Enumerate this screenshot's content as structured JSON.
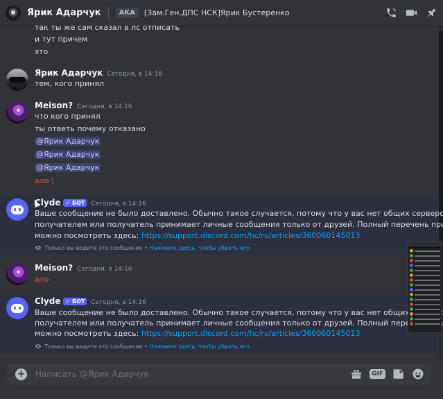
{
  "header": {
    "username": "Ярик Адарчук",
    "aka_badge": "AKA",
    "alias": "[Зам.Ген.ДПС НСК]Ярик Бустеренко",
    "icons": [
      "voice-call-icon",
      "video-call-icon",
      "pin-icon"
    ]
  },
  "messages": [
    {
      "author": "",
      "timestamp": "",
      "lines": [
        "так ты же сам сказал в лс отписать",
        "и тут причем",
        "это"
      ]
    },
    {
      "author": "Ярик Адарчук",
      "timestamp": "Сегодня, в 14:16",
      "lines": [
        "тем, кого принял"
      ]
    },
    {
      "author": "Meison?",
      "timestamp": "Сегодня, в 14:16",
      "lines": [
        "что кого принял",
        "ты ответь почему отказано"
      ],
      "mentions": [
        "@Ярик Адарчук",
        "@Ярик Адарчук",
        "@Ярик Адарчук"
      ],
      "red_line": "ало \\"
    },
    {
      "author": "Clyde",
      "bot_tag": "БОТ",
      "timestamp": "Сегодня, в 14:16",
      "lines": [
        "Ваше сообщение не было доставлено. Обычно такое случается, потому что у вас нет общих серверов с",
        "получателем или получатель принимает личные сообщения только от друзей. Полный перечень причин"
      ],
      "last_line_prefix": "можно посмотреть здесь: ",
      "link": "https://support.discord.com/hc/ru/articles/360060145013",
      "ephemeral_note": "Только вы видите это сообщение •",
      "dismiss": "Нажмите здесь, чтобы убрать его"
    },
    {
      "author": "Meison?",
      "timestamp": "Сегодня, в 14:16",
      "red_line": "ало"
    },
    {
      "author": "Clyde",
      "bot_tag": "БОТ",
      "timestamp": "Сегодня, в 14:16",
      "lines": [
        "Ваше сообщение не было доставлено. Обычно такое случается, потому что у вас нет общих серверов с",
        "получателем или получатель принимает личные сообщения только от друзей. Полный перечень причин"
      ],
      "last_line_prefix": "можно посмотреть здесь: ",
      "link": "https://support.discord.com/hc/ru/articles/360060145013",
      "ephemeral_note": "Только вы видите это сообщение •",
      "dismiss": "Нажмите здесь, чтобы убрать его"
    }
  ],
  "input": {
    "placeholder": "Написать @Ярик Адарчук",
    "gif_label": "GIF",
    "icons": [
      "gift-icon",
      "gif-icon",
      "sticker-icon",
      "emoji-icon"
    ]
  },
  "colors": {
    "background": "#313338",
    "highlight": "#2c2f3f",
    "mention_bg": "#3c4270",
    "link": "#00a8fc",
    "danger": "#f23f43",
    "blurple": "#5865f2"
  }
}
